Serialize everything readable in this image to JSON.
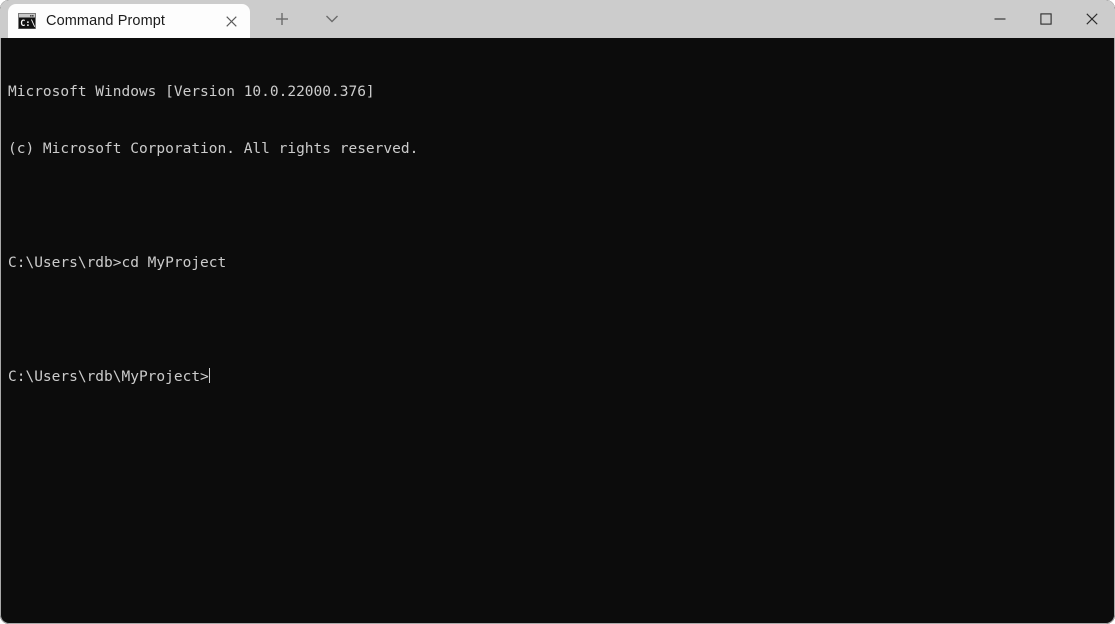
{
  "window": {
    "titlebar_color": "#cccccc",
    "terminal_bg": "#0c0c0c",
    "terminal_fg": "#cccccc",
    "active_tab_bg": "#fdfdfd"
  },
  "tabs": [
    {
      "label": "Command Prompt",
      "icon": "command-prompt-icon",
      "icon_text": "C:\\",
      "close_glyph": "✕",
      "active": true
    }
  ],
  "tabbar": {
    "new_tab_glyph": "+",
    "new_tab_name": "new-tab-button",
    "dropdown_glyph": "∨",
    "dropdown_name": "tab-dropdown-button"
  },
  "window_controls": {
    "minimize_glyph": "─",
    "maximize_glyph": "□",
    "close_glyph": "✕"
  },
  "terminal": {
    "lines": [
      "Microsoft Windows [Version 10.0.22000.376]",
      "(c) Microsoft Corporation. All rights reserved.",
      "",
      "C:\\Users\\rdb>cd MyProject",
      "",
      "C:\\Users\\rdb\\MyProject>"
    ],
    "prompt_line_index": 5,
    "cursor_visible": true
  }
}
